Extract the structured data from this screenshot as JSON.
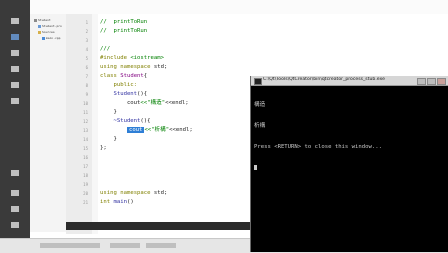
{
  "editor": {
    "lines": [
      {
        "n": "1",
        "tokens": [
          {
            "t": "//  ",
            "c": "cm"
          },
          {
            "t": "printToRun",
            "c": "cm"
          }
        ]
      },
      {
        "n": "2",
        "tokens": [
          {
            "t": "//  ",
            "c": "cm"
          },
          {
            "t": "printToRun",
            "c": "cm"
          }
        ]
      },
      {
        "n": "3",
        "tokens": []
      },
      {
        "n": "4",
        "tokens": [
          {
            "t": "///",
            "c": "cm"
          }
        ]
      },
      {
        "n": "5",
        "tokens": [
          {
            "t": "#include ",
            "c": "kw"
          },
          {
            "t": "<iostream>",
            "c": "st"
          }
        ]
      },
      {
        "n": "6",
        "tokens": [
          {
            "t": "using ",
            "c": "kw"
          },
          {
            "t": "namespace ",
            "c": "kw"
          },
          {
            "t": "std;",
            "c": "pl"
          }
        ]
      },
      {
        "n": "7",
        "tokens": [
          {
            "t": "class ",
            "c": "kw"
          },
          {
            "t": "Student",
            "c": "ty"
          },
          {
            "t": "{",
            "c": "pl"
          }
        ]
      },
      {
        "n": "8",
        "tokens": [
          {
            "t": "    public:",
            "c": "kw"
          }
        ]
      },
      {
        "n": "9",
        "tokens": [
          {
            "t": "    Student",
            "c": "df"
          },
          {
            "t": "(){",
            "c": "pl"
          }
        ]
      },
      {
        "n": "10",
        "tokens": [
          {
            "t": "        cout",
            "c": "pl"
          },
          {
            "t": "<<\"構造\"",
            "c": "st"
          },
          {
            "t": "<<endl;",
            "c": "pl"
          }
        ]
      },
      {
        "n": "11",
        "tokens": [
          {
            "t": "    }",
            "c": "pl"
          }
        ]
      },
      {
        "n": "12",
        "tokens": [
          {
            "t": "    ~Student",
            "c": "df"
          },
          {
            "t": "(){",
            "c": "pl"
          }
        ]
      },
      {
        "n": "13",
        "tokens": [
          {
            "t": "        ",
            "c": "pl"
          },
          {
            "t": "cout",
            "c": "hl"
          },
          {
            "t": "<<\"析構\"",
            "c": "st"
          },
          {
            "t": "<<endl;",
            "c": "pl"
          }
        ]
      },
      {
        "n": "14",
        "tokens": [
          {
            "t": "    }",
            "c": "pl"
          }
        ]
      },
      {
        "n": "15",
        "tokens": [
          {
            "t": "};",
            "c": "pl"
          }
        ]
      },
      {
        "n": "16",
        "tokens": []
      },
      {
        "n": "17",
        "tokens": []
      },
      {
        "n": "18",
        "tokens": []
      },
      {
        "n": "19",
        "tokens": []
      },
      {
        "n": "20",
        "tokens": [
          {
            "t": "using ",
            "c": "kw"
          },
          {
            "t": "namespace ",
            "c": "kw"
          },
          {
            "t": "std;",
            "c": "pl"
          }
        ]
      },
      {
        "n": "21",
        "tokens": [
          {
            "t": "int ",
            "c": "kw"
          },
          {
            "t": "main",
            "c": "df"
          },
          {
            "t": "()",
            "c": "pl"
          }
        ]
      }
    ]
  },
  "console": {
    "title": "C:\\Qt\\Tools\\QtCreator\\bin\\qtcreator_process_stub.exe",
    "lines": [
      "構造",
      "析構",
      "Press <RETURN> to close this window..."
    ]
  },
  "tree": {
    "items": [
      "Student",
      "Student.pro",
      "Sources",
      "main.cpp"
    ]
  },
  "colors": {
    "rail": "#3a3a3a",
    "highlight": "#2f7fd6",
    "keyword": "#808000",
    "comment": "#008000",
    "console_bg": "#000000"
  }
}
